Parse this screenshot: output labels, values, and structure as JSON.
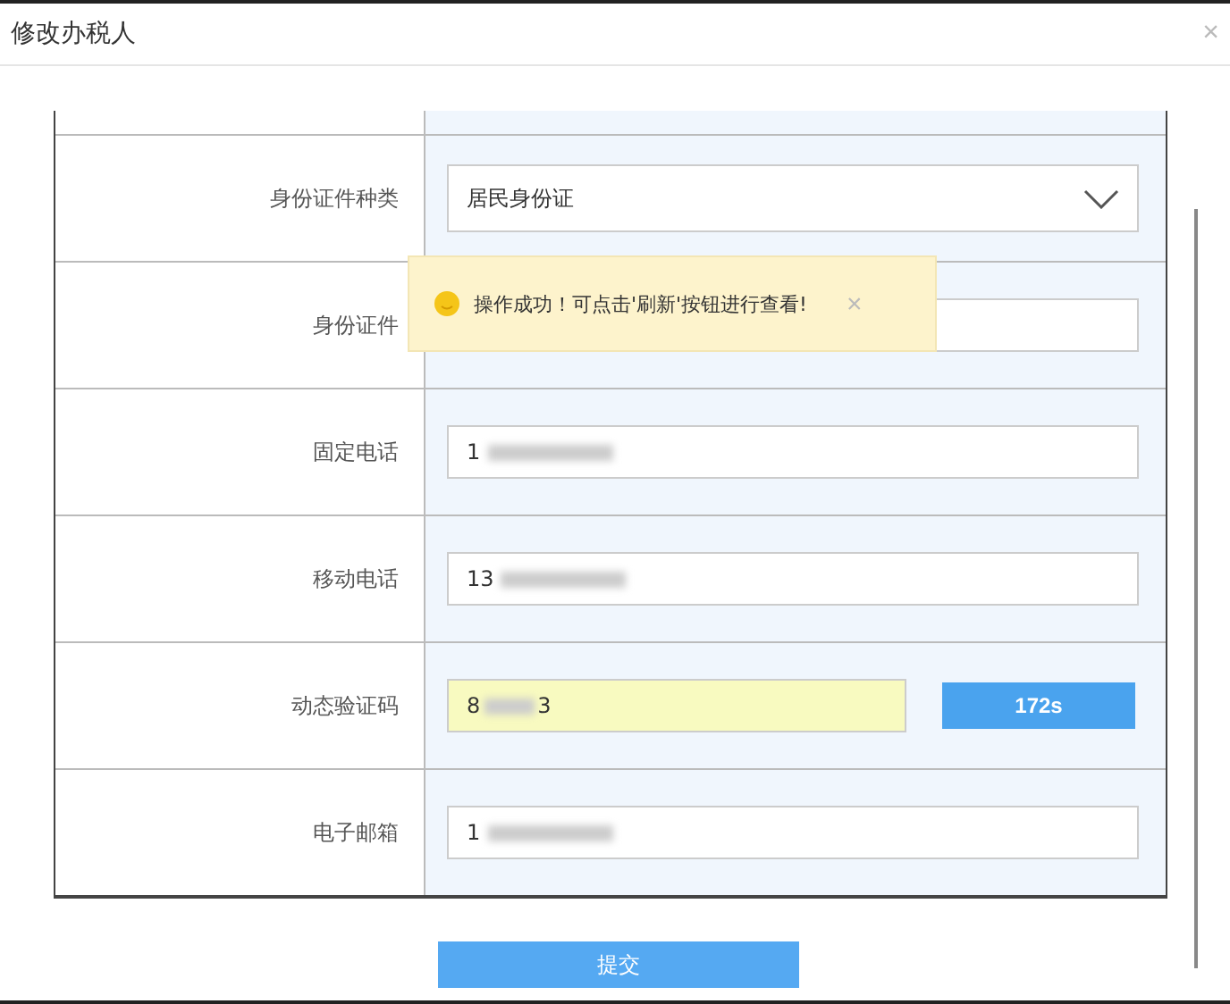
{
  "window": {
    "title": "修改办税人",
    "close": "×"
  },
  "rows": [
    {
      "label": "身份证件种类",
      "kind": "select",
      "value": "居民身份证"
    },
    {
      "label": "身份证件",
      "kind": "text"
    },
    {
      "label": "固定电话",
      "kind": "text",
      "value": "1",
      "redacted": true
    },
    {
      "label": "移动电话",
      "kind": "text",
      "value": "13",
      "redacted": true
    },
    {
      "label": "动态验证码",
      "kind": "code",
      "value": "8",
      "value_end": "3",
      "redacted": true,
      "button": "172s"
    },
    {
      "label": "电子邮箱",
      "kind": "text",
      "value": "1",
      "redacted": true
    }
  ],
  "toast": {
    "message": "操作成功！可点击'刷新'按钮进行查看!",
    "close": "×"
  },
  "submit": "提交"
}
